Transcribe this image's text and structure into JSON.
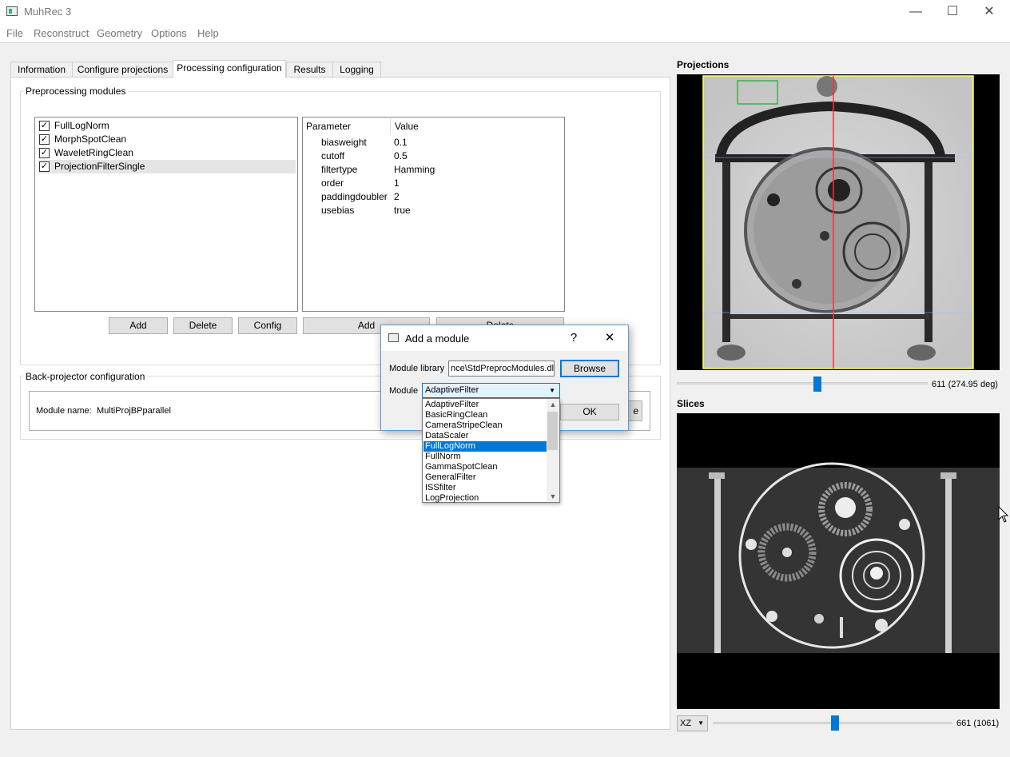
{
  "window": {
    "title": "MuhRec 3",
    "minimize": "—",
    "maximize": "☐",
    "close": "✕"
  },
  "menu": [
    "File",
    "Reconstruct",
    "Geometry",
    "Options",
    "Help"
  ],
  "tabs": [
    "Information",
    "Configure projections",
    "Processing configuration",
    "Results",
    "Logging"
  ],
  "active_tab": "Processing configuration",
  "preprocessing": {
    "group_title": "Preprocessing modules",
    "modules": [
      {
        "label": "FullLogNorm",
        "checked": true
      },
      {
        "label": "MorphSpotClean",
        "checked": true
      },
      {
        "label": "WaveletRingClean",
        "checked": true
      },
      {
        "label": "ProjectionFilterSingle",
        "checked": true
      }
    ],
    "checkmark": "✓",
    "params_header": {
      "name": "Parameter",
      "value": "Value"
    },
    "params": [
      {
        "name": "biasweight",
        "value": "0.1"
      },
      {
        "name": "cutoff",
        "value": "0.5"
      },
      {
        "name": "filtertype",
        "value": "Hamming"
      },
      {
        "name": "order",
        "value": "1"
      },
      {
        "name": "paddingdoubler",
        "value": "2"
      },
      {
        "name": "usebias",
        "value": "true"
      }
    ],
    "buttons": {
      "add": "Add",
      "delete": "Delete",
      "config": "Config",
      "param_add": "Add",
      "param_delete": "Delete"
    }
  },
  "backprojector": {
    "group_title": "Back-projector configuration",
    "module_name_label": "Module name:",
    "module_name": "MultiProjBPparallel",
    "partial_button": "e"
  },
  "projections": {
    "title": "Projections",
    "slider_value": "611 (274.95 deg)",
    "slider_fraction": 0.56
  },
  "slices": {
    "title": "Slices",
    "plane": "XZ",
    "slider_value": "661 (1061)",
    "slider_fraction": 0.51
  },
  "dialog": {
    "title": "Add a module",
    "help": "?",
    "close": "✕",
    "library_label": "Module library",
    "library_value": "nce\\StdPreprocModules.dll",
    "browse": "Browse",
    "module_label": "Module",
    "module_value": "AdaptiveFilter",
    "ok": "OK",
    "options": [
      "AdaptiveFilter",
      "BasicRingClean",
      "CameraStripeClean",
      "DataScaler",
      "FullLogNorm",
      "FullNorm",
      "GammaSpotClean",
      "GeneralFilter",
      "ISSfilter",
      "LogProjection"
    ],
    "highlighted": "FullLogNorm"
  },
  "colors": {
    "accent": "#0078d7",
    "selection": "#e5e5e5",
    "roi_box": "#3cb043",
    "center_line": "#ff3030",
    "frame": "#ffff66"
  },
  "icons": {
    "dropdown": "▼",
    "scroll_up": "▲",
    "scroll_down": "▼"
  }
}
